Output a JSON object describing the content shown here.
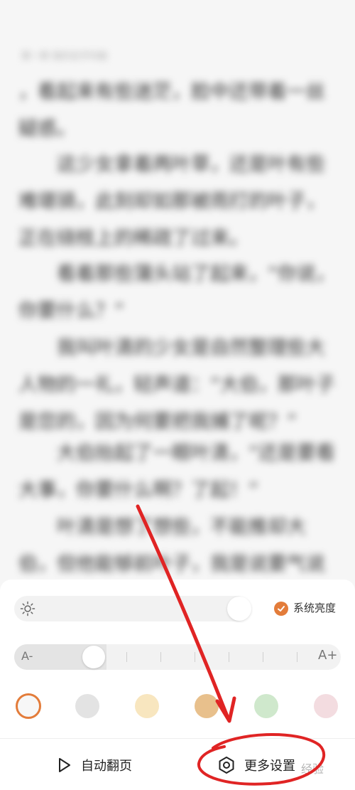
{
  "reading": {
    "chapter_title": "第一章 我的名字叫做",
    "paragraphs": [
      "，看起来有些迷茫，脸中还带着一丝疑惑。",
      "这少女拿着两叶草，还是叶有些难堪骑，此刻却如那被雨打的叶子，正在绕枝上的稀疏了过来。",
      "看着那些蒲头站了起来，“你说，你要什么？”",
      "我叫叶清的少女是自然整理些大人物的一礼，轻声道：“大伯，那叶子是您的，因为何要把我捕了呢？”",
      "大伯抬起了一眼叶清，“还是要看大事，你要什么啊？了起！”",
      "叶清是想了想些，不能推却大伯，但他能够前叶子，我是说要气说"
    ]
  },
  "panel": {
    "system_brightness_label": "系统亮度",
    "brightness_level": 0.95,
    "font_small_label": "A-",
    "font_large_label": "A+",
    "font_size_level": 0.25,
    "background_swatches": [
      {
        "name": "white",
        "color": "#f7f7f7",
        "selected": true
      },
      {
        "name": "gray",
        "color": "#e3e3e3",
        "selected": false
      },
      {
        "name": "light-yellow",
        "color": "#f8e6bf",
        "selected": false
      },
      {
        "name": "tan",
        "color": "#e8c08c",
        "selected": false
      },
      {
        "name": "light-green",
        "color": "#cfe8cc",
        "selected": false
      },
      {
        "name": "pink",
        "color": "#f3dce0",
        "selected": false
      }
    ],
    "auto_page_label": "自动翻页",
    "more_settings_label": "更多设置"
  },
  "accent_color": "#e37c3a",
  "annotation_color": "#e02424",
  "watermark_text": "经验"
}
